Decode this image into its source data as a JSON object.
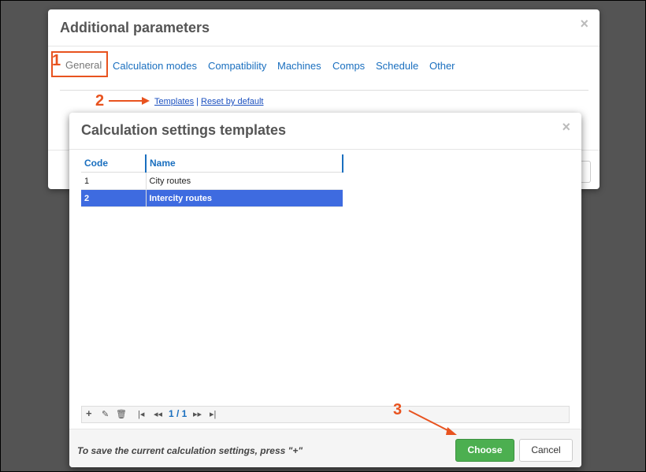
{
  "back_dialog": {
    "title": "Additional parameters",
    "close": "×",
    "tabs": [
      "General",
      "Calculation modes",
      "Compatibility",
      "Machines",
      "Comps",
      "Schedule",
      "Other"
    ],
    "links": {
      "templates": "Templates",
      "separator": "|",
      "reset": "Reset by default"
    }
  },
  "callouts": {
    "one": "1",
    "two": "2",
    "three": "3",
    "color": "#e8531f"
  },
  "front_dialog": {
    "title": "Calculation settings templates",
    "close": "×",
    "columns": [
      "Code",
      "Name"
    ],
    "rows": [
      {
        "code": "1",
        "name": "City routes",
        "selected": false
      },
      {
        "code": "2",
        "name": "Intercity routes",
        "selected": true
      }
    ],
    "pager": {
      "add": "+",
      "edit": "✎",
      "delete": "🗑",
      "first": "|◂",
      "prev": "◂◂",
      "page": "1 / 1",
      "next": "▸▸",
      "last": "▸|"
    },
    "hint": "To save the current calculation settings, press \"+\"",
    "choose_label": "Choose",
    "cancel_label": "Cancel"
  },
  "colors": {
    "accent": "#1a6fbf",
    "selection": "#3e6be0",
    "choose": "#4caf50"
  }
}
